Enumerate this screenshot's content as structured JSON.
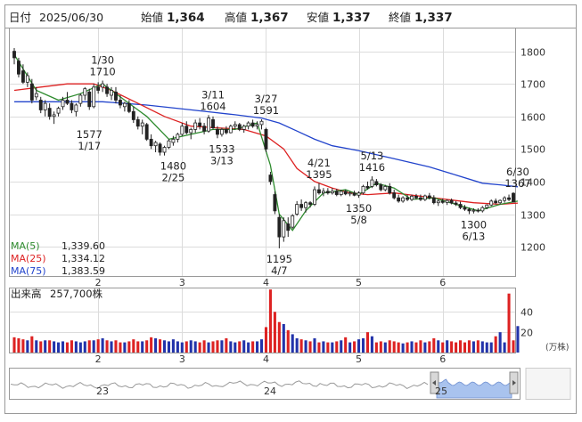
{
  "header": {
    "date_label": "日付",
    "date": "2025/06/30",
    "open_label": "始値",
    "open": "1,364",
    "high_label": "高値",
    "high": "1,367",
    "low_label": "安値",
    "low": "1,337",
    "close_label": "終値",
    "close": "1,337"
  },
  "colors": {
    "up": "#1f7a1f",
    "down": "#cc0000",
    "neutral": "#222222",
    "ma5": "#2e8b2e",
    "ma25": "#dd2222",
    "ma75": "#2244cc",
    "vol_up": "#2233aa",
    "vol_down": "#dd2222",
    "nav_fill": "#a9c3ee"
  },
  "ma_legend": [
    {
      "label": "MA(5)",
      "value": "1,339.60",
      "color": "#2e8b2e"
    },
    {
      "label": "MA(25)",
      "value": "1,334.12",
      "color": "#dd2222"
    },
    {
      "label": "MA(75)",
      "value": "1,383.59",
      "color": "#2244cc"
    }
  ],
  "volume_label": "出来高",
  "volume_value": "257,700株",
  "volume_unit": "(万株)",
  "nav": {
    "labels": [
      "23",
      "24",
      "25"
    ]
  },
  "chart_data": {
    "type": "candlestick",
    "x_unit": "trading days, 2025-01-06 to 2025-06-30",
    "months": [
      {
        "label": "2",
        "day": 19
      },
      {
        "label": "3",
        "day": 38
      },
      {
        "label": "4",
        "day": 57
      },
      {
        "label": "5",
        "day": 78
      },
      {
        "label": "6",
        "day": 97
      }
    ],
    "y_ticks": [
      1200,
      1300,
      1400,
      1500,
      1600,
      1700,
      1800
    ],
    "ylim": [
      1110,
      1870
    ],
    "annotations": [
      {
        "day": 17,
        "date": "1/17",
        "value": 1577,
        "pos": "below"
      },
      {
        "day": 20,
        "date": "1/30",
        "value": 1710,
        "pos": "above"
      },
      {
        "day": 36,
        "date": "2/25",
        "value": 1480,
        "pos": "below"
      },
      {
        "day": 45,
        "date": "3/11",
        "value": 1604,
        "pos": "above"
      },
      {
        "day": 47,
        "date": "3/13",
        "value": 1533,
        "pos": "below"
      },
      {
        "day": 57,
        "date": "3/27",
        "value": 1591,
        "pos": "above"
      },
      {
        "day": 60,
        "date": "4/7",
        "value": 1195,
        "pos": "below"
      },
      {
        "day": 69,
        "date": "4/21",
        "value": 1395,
        "pos": "above"
      },
      {
        "day": 78,
        "date": "5/8",
        "value": 1350,
        "pos": "below"
      },
      {
        "day": 81,
        "date": "5/13",
        "value": 1416,
        "pos": "above"
      },
      {
        "day": 104,
        "date": "6/13",
        "value": 1300,
        "pos": "below"
      },
      {
        "day": 114,
        "date": "6/30",
        "value": 1367,
        "pos": "above"
      }
    ],
    "ma_series": {
      "ma5": [
        [
          0,
          1790
        ],
        [
          5,
          1680
        ],
        [
          10,
          1650
        ],
        [
          15,
          1670
        ],
        [
          20,
          1700
        ],
        [
          25,
          1650
        ],
        [
          30,
          1600
        ],
        [
          35,
          1530
        ],
        [
          40,
          1545
        ],
        [
          45,
          1560
        ],
        [
          50,
          1560
        ],
        [
          55,
          1580
        ],
        [
          58,
          1450
        ],
        [
          60,
          1300
        ],
        [
          63,
          1250
        ],
        [
          66,
          1310
        ],
        [
          70,
          1365
        ],
        [
          75,
          1375
        ],
        [
          78,
          1360
        ],
        [
          82,
          1395
        ],
        [
          86,
          1380
        ],
        [
          90,
          1345
        ],
        [
          95,
          1350
        ],
        [
          100,
          1330
        ],
        [
          105,
          1310
        ],
        [
          110,
          1330
        ],
        [
          114,
          1340
        ]
      ],
      "ma25": [
        [
          0,
          1680
        ],
        [
          6,
          1690
        ],
        [
          12,
          1700
        ],
        [
          18,
          1700
        ],
        [
          22,
          1680
        ],
        [
          28,
          1640
        ],
        [
          34,
          1600
        ],
        [
          40,
          1570
        ],
        [
          46,
          1565
        ],
        [
          52,
          1560
        ],
        [
          57,
          1540
        ],
        [
          61,
          1500
        ],
        [
          64,
          1440
        ],
        [
          68,
          1400
        ],
        [
          72,
          1380
        ],
        [
          76,
          1365
        ],
        [
          80,
          1360
        ],
        [
          86,
          1365
        ],
        [
          92,
          1355
        ],
        [
          98,
          1345
        ],
        [
          104,
          1335
        ],
        [
          110,
          1330
        ],
        [
          114,
          1334
        ]
      ],
      "ma75": [
        [
          0,
          1645
        ],
        [
          10,
          1645
        ],
        [
          20,
          1645
        ],
        [
          30,
          1635
        ],
        [
          40,
          1620
        ],
        [
          50,
          1605
        ],
        [
          56,
          1595
        ],
        [
          60,
          1580
        ],
        [
          64,
          1555
        ],
        [
          68,
          1530
        ],
        [
          72,
          1510
        ],
        [
          78,
          1495
        ],
        [
          86,
          1470
        ],
        [
          94,
          1445
        ],
        [
          100,
          1420
        ],
        [
          106,
          1395
        ],
        [
          110,
          1390
        ],
        [
          114,
          1384
        ]
      ]
    },
    "candles": [
      {
        "o": 1800,
        "h": 1810,
        "l": 1760,
        "c": 1780
      },
      {
        "o": 1770,
        "h": 1780,
        "l": 1720,
        "c": 1730
      },
      {
        "o": 1740,
        "h": 1760,
        "l": 1700,
        "c": 1705
      },
      {
        "o": 1705,
        "h": 1735,
        "l": 1690,
        "c": 1725
      },
      {
        "o": 1700,
        "h": 1715,
        "l": 1640,
        "c": 1650
      },
      {
        "o": 1660,
        "h": 1690,
        "l": 1650,
        "c": 1670
      },
      {
        "o": 1650,
        "h": 1660,
        "l": 1610,
        "c": 1620
      },
      {
        "o": 1620,
        "h": 1650,
        "l": 1600,
        "c": 1640
      },
      {
        "o": 1625,
        "h": 1640,
        "l": 1590,
        "c": 1600
      },
      {
        "o": 1600,
        "h": 1615,
        "l": 1577,
        "c": 1605
      },
      {
        "o": 1610,
        "h": 1630,
        "l": 1600,
        "c": 1625
      },
      {
        "o": 1630,
        "h": 1660,
        "l": 1620,
        "c": 1650
      },
      {
        "o": 1650,
        "h": 1675,
        "l": 1635,
        "c": 1640
      },
      {
        "o": 1640,
        "h": 1650,
        "l": 1610,
        "c": 1620
      },
      {
        "o": 1615,
        "h": 1640,
        "l": 1600,
        "c": 1635
      },
      {
        "o": 1640,
        "h": 1670,
        "l": 1630,
        "c": 1665
      },
      {
        "o": 1665,
        "h": 1690,
        "l": 1650,
        "c": 1685
      },
      {
        "o": 1675,
        "h": 1685,
        "l": 1620,
        "c": 1630
      },
      {
        "o": 1630,
        "h": 1700,
        "l": 1625,
        "c": 1690
      },
      {
        "o": 1690,
        "h": 1705,
        "l": 1670,
        "c": 1680
      },
      {
        "o": 1690,
        "h": 1710,
        "l": 1675,
        "c": 1700
      },
      {
        "o": 1690,
        "h": 1700,
        "l": 1660,
        "c": 1670
      },
      {
        "o": 1665,
        "h": 1690,
        "l": 1650,
        "c": 1680
      },
      {
        "o": 1675,
        "h": 1690,
        "l": 1640,
        "c": 1650
      },
      {
        "o": 1650,
        "h": 1665,
        "l": 1625,
        "c": 1635
      },
      {
        "o": 1630,
        "h": 1645,
        "l": 1615,
        "c": 1640
      },
      {
        "o": 1640,
        "h": 1650,
        "l": 1610,
        "c": 1615
      },
      {
        "o": 1615,
        "h": 1630,
        "l": 1580,
        "c": 1590
      },
      {
        "o": 1590,
        "h": 1600,
        "l": 1560,
        "c": 1570
      },
      {
        "o": 1570,
        "h": 1590,
        "l": 1545,
        "c": 1580
      },
      {
        "o": 1575,
        "h": 1580,
        "l": 1525,
        "c": 1530
      },
      {
        "o": 1530,
        "h": 1545,
        "l": 1500,
        "c": 1510
      },
      {
        "o": 1510,
        "h": 1525,
        "l": 1490,
        "c": 1520
      },
      {
        "o": 1515,
        "h": 1520,
        "l": 1480,
        "c": 1490
      },
      {
        "o": 1490,
        "h": 1510,
        "l": 1480,
        "c": 1505
      },
      {
        "o": 1505,
        "h": 1530,
        "l": 1500,
        "c": 1525
      },
      {
        "o": 1520,
        "h": 1540,
        "l": 1510,
        "c": 1530
      },
      {
        "o": 1530,
        "h": 1550,
        "l": 1520,
        "c": 1545
      },
      {
        "o": 1545,
        "h": 1580,
        "l": 1540,
        "c": 1570
      },
      {
        "o": 1570,
        "h": 1585,
        "l": 1545,
        "c": 1550
      },
      {
        "o": 1550,
        "h": 1565,
        "l": 1530,
        "c": 1560
      },
      {
        "o": 1560,
        "h": 1590,
        "l": 1550,
        "c": 1580
      },
      {
        "o": 1580,
        "h": 1595,
        "l": 1560,
        "c": 1570
      },
      {
        "o": 1570,
        "h": 1580,
        "l": 1545,
        "c": 1555
      },
      {
        "o": 1555,
        "h": 1604,
        "l": 1550,
        "c": 1595
      },
      {
        "o": 1590,
        "h": 1600,
        "l": 1560,
        "c": 1565
      },
      {
        "o": 1560,
        "h": 1570,
        "l": 1533,
        "c": 1545
      },
      {
        "o": 1545,
        "h": 1565,
        "l": 1538,
        "c": 1560
      },
      {
        "o": 1560,
        "h": 1570,
        "l": 1545,
        "c": 1550
      },
      {
        "o": 1550,
        "h": 1575,
        "l": 1548,
        "c": 1570
      },
      {
        "o": 1570,
        "h": 1585,
        "l": 1560,
        "c": 1575
      },
      {
        "o": 1575,
        "h": 1580,
        "l": 1555,
        "c": 1560
      },
      {
        "o": 1560,
        "h": 1575,
        "l": 1550,
        "c": 1570
      },
      {
        "o": 1570,
        "h": 1585,
        "l": 1560,
        "c": 1580
      },
      {
        "o": 1580,
        "h": 1590,
        "l": 1565,
        "c": 1570
      },
      {
        "o": 1570,
        "h": 1585,
        "l": 1560,
        "c": 1575
      },
      {
        "o": 1575,
        "h": 1591,
        "l": 1560,
        "c": 1585
      },
      {
        "o": 1560,
        "h": 1565,
        "l": 1490,
        "c": 1500
      },
      {
        "o": 1420,
        "h": 1430,
        "l": 1390,
        "c": 1400
      },
      {
        "o": 1360,
        "h": 1370,
        "l": 1300,
        "c": 1310
      },
      {
        "o": 1290,
        "h": 1300,
        "l": 1195,
        "c": 1230
      },
      {
        "o": 1230,
        "h": 1290,
        "l": 1215,
        "c": 1280
      },
      {
        "o": 1270,
        "h": 1290,
        "l": 1230,
        "c": 1250
      },
      {
        "o": 1260,
        "h": 1300,
        "l": 1255,
        "c": 1295
      },
      {
        "o": 1300,
        "h": 1340,
        "l": 1295,
        "c": 1330
      },
      {
        "o": 1330,
        "h": 1345,
        "l": 1310,
        "c": 1320
      },
      {
        "o": 1320,
        "h": 1340,
        "l": 1305,
        "c": 1335
      },
      {
        "o": 1335,
        "h": 1340,
        "l": 1320,
        "c": 1330
      },
      {
        "o": 1330,
        "h": 1385,
        "l": 1325,
        "c": 1375
      },
      {
        "o": 1375,
        "h": 1395,
        "l": 1360,
        "c": 1365
      },
      {
        "o": 1365,
        "h": 1380,
        "l": 1355,
        "c": 1370
      },
      {
        "o": 1370,
        "h": 1380,
        "l": 1360,
        "c": 1365
      },
      {
        "o": 1365,
        "h": 1380,
        "l": 1360,
        "c": 1370
      },
      {
        "o": 1370,
        "h": 1378,
        "l": 1355,
        "c": 1360
      },
      {
        "o": 1360,
        "h": 1375,
        "l": 1355,
        "c": 1370
      },
      {
        "o": 1370,
        "h": 1375,
        "l": 1358,
        "c": 1362
      },
      {
        "o": 1362,
        "h": 1370,
        "l": 1355,
        "c": 1365
      },
      {
        "o": 1365,
        "h": 1372,
        "l": 1355,
        "c": 1358
      },
      {
        "o": 1358,
        "h": 1370,
        "l": 1350,
        "c": 1365
      },
      {
        "o": 1365,
        "h": 1390,
        "l": 1360,
        "c": 1385
      },
      {
        "o": 1385,
        "h": 1400,
        "l": 1375,
        "c": 1380
      },
      {
        "o": 1385,
        "h": 1416,
        "l": 1380,
        "c": 1405
      },
      {
        "o": 1400,
        "h": 1408,
        "l": 1385,
        "c": 1390
      },
      {
        "o": 1390,
        "h": 1395,
        "l": 1370,
        "c": 1375
      },
      {
        "o": 1375,
        "h": 1390,
        "l": 1370,
        "c": 1385
      },
      {
        "o": 1385,
        "h": 1395,
        "l": 1360,
        "c": 1365
      },
      {
        "o": 1365,
        "h": 1375,
        "l": 1345,
        "c": 1350
      },
      {
        "o": 1350,
        "h": 1360,
        "l": 1335,
        "c": 1340
      },
      {
        "o": 1340,
        "h": 1355,
        "l": 1335,
        "c": 1350
      },
      {
        "o": 1350,
        "h": 1360,
        "l": 1340,
        "c": 1345
      },
      {
        "o": 1345,
        "h": 1360,
        "l": 1340,
        "c": 1355
      },
      {
        "o": 1355,
        "h": 1362,
        "l": 1345,
        "c": 1350
      },
      {
        "o": 1350,
        "h": 1360,
        "l": 1340,
        "c": 1345
      },
      {
        "o": 1345,
        "h": 1360,
        "l": 1340,
        "c": 1356
      },
      {
        "o": 1356,
        "h": 1365,
        "l": 1345,
        "c": 1350
      },
      {
        "o": 1350,
        "h": 1358,
        "l": 1330,
        "c": 1335
      },
      {
        "o": 1335,
        "h": 1345,
        "l": 1325,
        "c": 1340
      },
      {
        "o": 1340,
        "h": 1348,
        "l": 1332,
        "c": 1336
      },
      {
        "o": 1336,
        "h": 1345,
        "l": 1328,
        "c": 1342
      },
      {
        "o": 1342,
        "h": 1348,
        "l": 1330,
        "c": 1334
      },
      {
        "o": 1334,
        "h": 1340,
        "l": 1325,
        "c": 1330
      },
      {
        "o": 1330,
        "h": 1338,
        "l": 1315,
        "c": 1320
      },
      {
        "o": 1320,
        "h": 1328,
        "l": 1310,
        "c": 1315
      },
      {
        "o": 1315,
        "h": 1320,
        "l": 1300,
        "c": 1310
      },
      {
        "o": 1310,
        "h": 1318,
        "l": 1302,
        "c": 1312
      },
      {
        "o": 1312,
        "h": 1318,
        "l": 1305,
        "c": 1310
      },
      {
        "o": 1310,
        "h": 1325,
        "l": 1305,
        "c": 1320
      },
      {
        "o": 1320,
        "h": 1330,
        "l": 1315,
        "c": 1328
      },
      {
        "o": 1328,
        "h": 1345,
        "l": 1325,
        "c": 1340
      },
      {
        "o": 1340,
        "h": 1348,
        "l": 1330,
        "c": 1335
      },
      {
        "o": 1335,
        "h": 1345,
        "l": 1330,
        "c": 1342
      },
      {
        "o": 1342,
        "h": 1355,
        "l": 1335,
        "c": 1350
      },
      {
        "o": 1350,
        "h": 1360,
        "l": 1340,
        "c": 1345
      },
      {
        "o": 1364,
        "h": 1367,
        "l": 1337,
        "c": 1337
      }
    ],
    "volume": {
      "y_ticks": [
        20,
        40
      ],
      "ylim": [
        0,
        63
      ],
      "values": [
        15,
        14,
        13,
        12,
        16,
        12,
        11,
        12,
        12,
        11,
        10,
        11,
        10,
        12,
        11,
        10,
        11,
        12,
        12,
        13,
        14,
        12,
        11,
        12,
        10,
        10,
        11,
        13,
        11,
        11,
        12,
        15,
        14,
        13,
        12,
        11,
        13,
        11,
        10,
        11,
        12,
        11,
        10,
        12,
        10,
        11,
        12,
        12,
        14,
        11,
        10,
        11,
        12,
        10,
        11,
        11,
        13,
        25,
        62,
        40,
        30,
        28,
        22,
        18,
        14,
        13,
        12,
        11,
        14,
        10,
        11,
        10,
        10,
        11,
        12,
        15,
        10,
        11,
        13,
        14,
        20,
        16,
        10,
        11,
        10,
        12,
        11,
        10,
        9,
        10,
        11,
        10,
        12,
        10,
        11,
        14,
        12,
        10,
        12,
        11,
        10,
        12,
        10,
        12,
        11,
        12,
        11,
        10,
        10,
        16,
        20,
        10,
        58,
        12,
        26
      ]
    }
  }
}
